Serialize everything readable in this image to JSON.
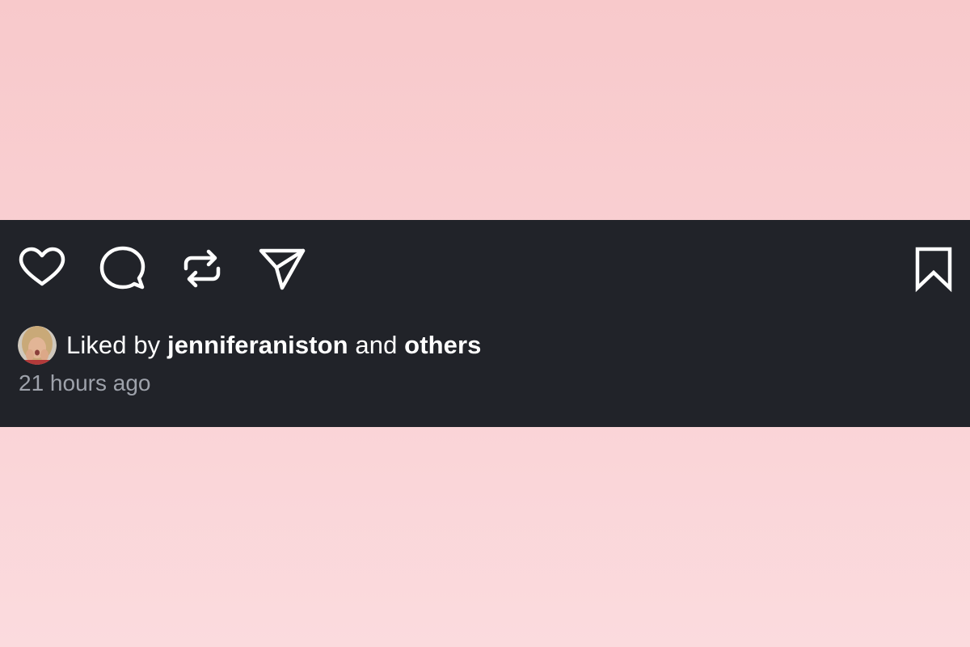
{
  "post": {
    "actions": {
      "like": "heart-icon",
      "comment": "comment-icon",
      "repost": "repost-icon",
      "share": "send-icon",
      "save": "bookmark-icon"
    },
    "likes": {
      "prefix": "Liked by",
      "user": "jenniferaniston",
      "joiner": "and",
      "others": "others"
    },
    "timestamp": "21 hours ago"
  },
  "colors": {
    "background_top": "#f8c9cb",
    "background_bottom": "#fbdbde",
    "bar": "#212329",
    "text": "#ffffff",
    "muted_text": "#9ea2ab"
  }
}
